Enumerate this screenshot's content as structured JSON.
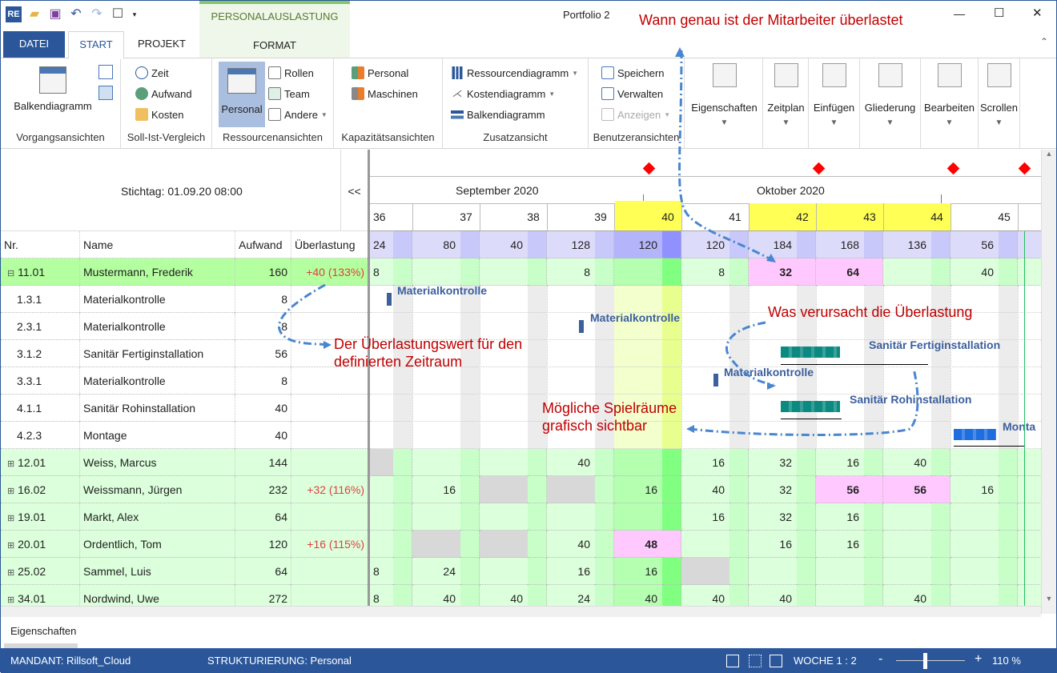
{
  "window": {
    "title": "Portfolio 2",
    "context_tab": "PERSONALAUSLASTUNG",
    "controls": [
      "—",
      "☐",
      "✕"
    ]
  },
  "tabs": [
    "DATEI",
    "START",
    "PROJEKT",
    "FORMAT"
  ],
  "ribbon": {
    "vorgang": {
      "big": "Balkendiagramm",
      "label": "Vorgangsansichten"
    },
    "sollist": {
      "items": [
        "Zeit",
        "Aufwand",
        "Kosten"
      ],
      "label": "Soll-Ist-Vergleich"
    },
    "ressourcen": {
      "big": "Personal",
      "items": [
        "Rollen",
        "Team",
        "Andere"
      ],
      "label": "Ressourcenansichten"
    },
    "kapazitaet": {
      "items": [
        "Personal",
        "Maschinen"
      ],
      "label": "Kapazitätsansichten"
    },
    "zusatz": {
      "items": [
        "Ressourcendiagramm",
        "Kostendiagramm",
        "Balkendiagramm"
      ],
      "label": "Zusatzansicht"
    },
    "benutzer": {
      "items": [
        "Speichern",
        "Verwalten",
        "Anzeigen"
      ],
      "label": "Benutzeransichten"
    },
    "bigbuttons": [
      "Eigenschaften",
      "Zeitplan",
      "Einfügen",
      "Gliederung",
      "Bearbeiten",
      "Scrollen"
    ]
  },
  "stichtag": "Stichtag: 01.09.20 08:00",
  "collapse": "<<",
  "months": [
    "September 2020",
    "Oktober 2020"
  ],
  "weeks": [
    "36",
    "37",
    "38",
    "39",
    "40",
    "41",
    "42",
    "43",
    "44",
    "45"
  ],
  "highlight_weeks": [
    "40",
    "42",
    "43",
    "44"
  ],
  "columns": [
    "Nr.",
    "Name",
    "Aufwand",
    "Überlastung"
  ],
  "summary": [
    "24",
    "80",
    "40",
    "128",
    "120",
    "120",
    "184",
    "168",
    "136",
    "56"
  ],
  "rows": [
    {
      "nr": "11.01",
      "name": "Mustermann, Frederik",
      "aufwand": "160",
      "ueber": "+40 (133%)",
      "type": "res",
      "exp": "⊟",
      "cells": [
        "8",
        "",
        "",
        "8",
        "",
        "8",
        "32",
        "64",
        "",
        "40"
      ],
      "over": [
        6,
        7
      ],
      "grey": []
    },
    {
      "nr": "1.3.1",
      "name": "Materialkontrolle",
      "aufwand": "8",
      "ueber": "",
      "type": "task"
    },
    {
      "nr": "2.3.1",
      "name": "Materialkontrolle",
      "aufwand": "8",
      "ueber": "",
      "type": "task"
    },
    {
      "nr": "3.1.2",
      "name": "Sanitär Fertiginstallation",
      "aufwand": "56",
      "ueber": "",
      "type": "task"
    },
    {
      "nr": "3.3.1",
      "name": "Materialkontrolle",
      "aufwand": "8",
      "ueber": "",
      "type": "task"
    },
    {
      "nr": "4.1.1",
      "name": "Sanitär Rohinstallation",
      "aufwand": "40",
      "ueber": "",
      "type": "task"
    },
    {
      "nr": "4.2.3",
      "name": "Montage",
      "aufwand": "40",
      "ueber": "",
      "type": "task"
    },
    {
      "nr": "12.01",
      "name": "Weiss, Marcus",
      "aufwand": "144",
      "ueber": "",
      "type": "res",
      "exp": "⊞",
      "cells": [
        "",
        "",
        "",
        "40",
        "",
        "16",
        "32",
        "16",
        "40",
        ""
      ],
      "over": [],
      "grey": [
        0
      ]
    },
    {
      "nr": "16.02",
      "name": "Weissmann, Jürgen",
      "aufwand": "232",
      "ueber": "+32 (116%)",
      "type": "res",
      "exp": "⊞",
      "cells": [
        "",
        "16",
        "",
        "",
        "16",
        "40",
        "32",
        "56",
        "56",
        "16"
      ],
      "over": [
        7,
        8
      ],
      "grey": [
        2,
        3
      ]
    },
    {
      "nr": "19.01",
      "name": "Markt, Alex",
      "aufwand": "64",
      "ueber": "",
      "type": "res",
      "exp": "⊞",
      "cells": [
        "",
        "",
        "",
        "",
        "",
        "16",
        "32",
        "16",
        "",
        ""
      ],
      "over": [],
      "grey": []
    },
    {
      "nr": "20.01",
      "name": "Ordentlich, Tom",
      "aufwand": "120",
      "ueber": "+16 (115%)",
      "type": "res",
      "exp": "⊞",
      "cells": [
        "",
        "",
        "",
        "40",
        "48",
        "",
        "16",
        "16",
        "",
        ""
      ],
      "over": [
        4
      ],
      "grey": [
        1,
        2
      ]
    },
    {
      "nr": "25.02",
      "name": "Sammel, Luis",
      "aufwand": "64",
      "ueber": "",
      "type": "res",
      "exp": "⊞",
      "cells": [
        "8",
        "24",
        "",
        "16",
        "16",
        "",
        "",
        "",
        "",
        ""
      ],
      "over": [],
      "grey": [
        5
      ]
    },
    {
      "nr": "34.01",
      "name": "Nordwind, Uwe",
      "aufwand": "272",
      "ueber": "",
      "type": "res",
      "exp": "⊞",
      "cells": [
        "8",
        "40",
        "40",
        "24",
        "40",
        "40",
        "40",
        "",
        "40",
        ""
      ],
      "over": [],
      "grey": []
    }
  ],
  "bars": [
    {
      "row": 1,
      "label": "Materialkontrolle"
    },
    {
      "row": 2,
      "label": "Materialkontrolle"
    },
    {
      "row": 3,
      "label": "Sanitär Fertiginstallation"
    },
    {
      "row": 4,
      "label": "Materialkontrolle"
    },
    {
      "row": 5,
      "label": "Sanitär Rohinstallation"
    },
    {
      "row": 6,
      "label": "Monta"
    }
  ],
  "annotations": {
    "a1": "Wann genau ist der Mitarbeiter überlastet",
    "a2": "Was verursacht die Überlastung",
    "a3": "Der Überlastungswert für den definierten Zeitraum",
    "a4": "Mögliche Spielräume grafisch sichtbar"
  },
  "bottom_tab": "Eigenschaften",
  "status": {
    "mandant": "MANDANT: Rillsoft_Cloud",
    "struktur": "STRUKTURIERUNG: Personal",
    "scale": "WOCHE 1 : 2",
    "zoom": "110 %"
  },
  "colors": {
    "accent": "#2b579a",
    "overload": "#ffc8ff",
    "resource": "#dcffdc",
    "summary": "#dcdcfa",
    "highlight": "#ffff55",
    "annotation": "#c00000"
  }
}
